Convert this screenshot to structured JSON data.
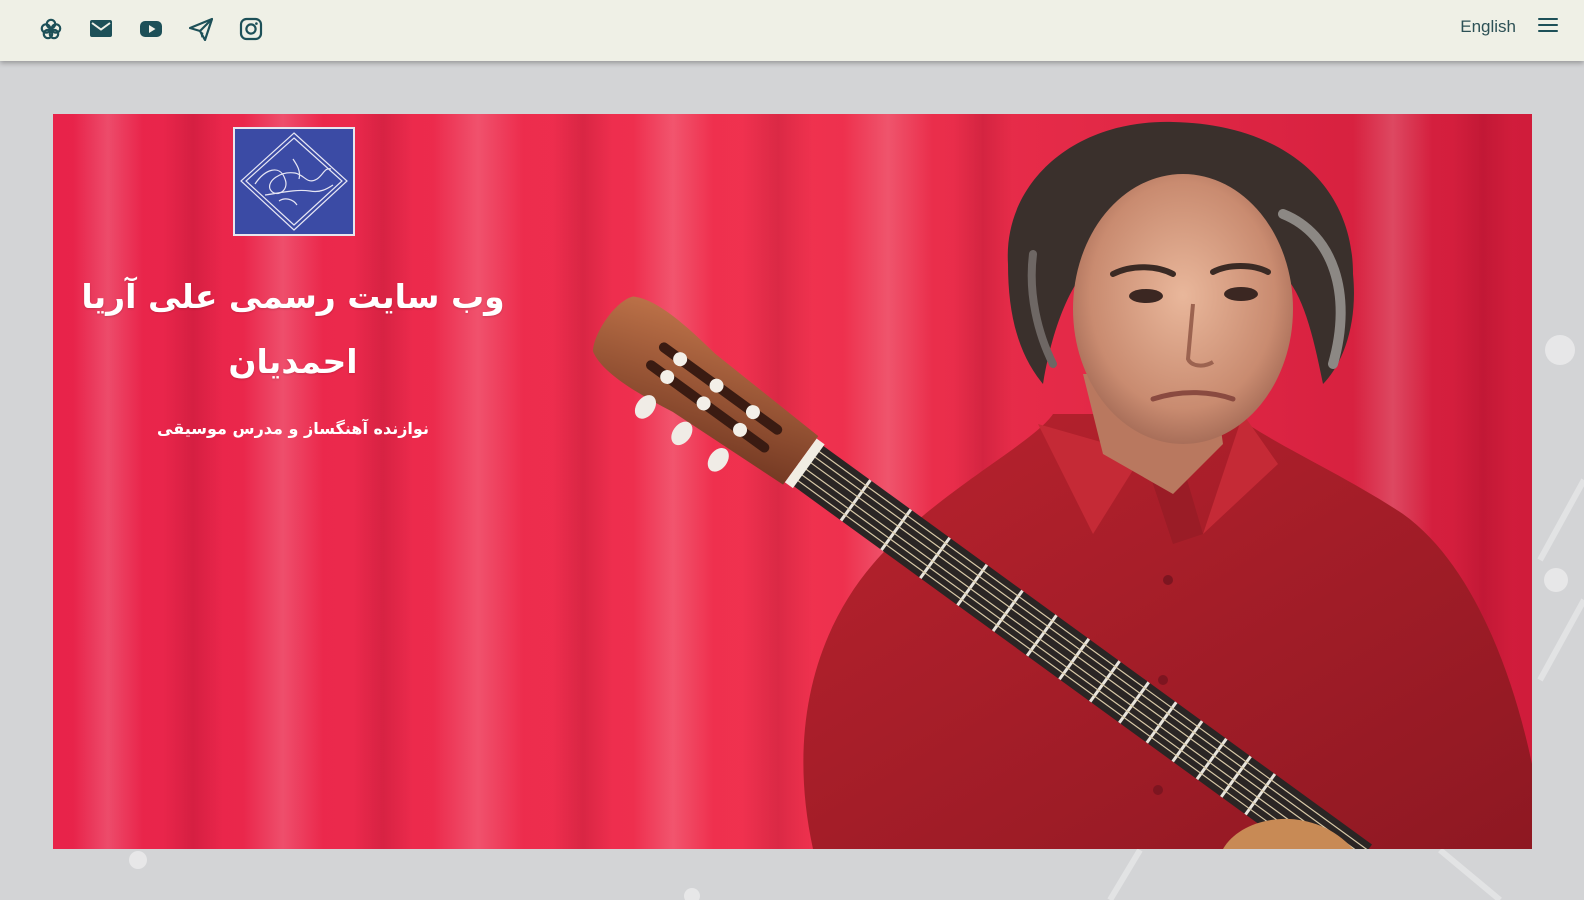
{
  "topbar": {
    "social_icons": [
      {
        "name": "flower-icon"
      },
      {
        "name": "mail-icon"
      },
      {
        "name": "youtube-icon"
      },
      {
        "name": "telegram-icon"
      },
      {
        "name": "instagram-icon"
      }
    ],
    "language_link": "English",
    "menu_icon": "hamburger-menu-icon"
  },
  "hero": {
    "logo_text": "علی آریا احمدیان",
    "title_line1": "وب سایت رسمی علی آریا",
    "title_line2": "احمدیان",
    "subtitle": "نوازنده آهنگساز و مدرس موسیقی",
    "photo": "portrait-with-guitar-image"
  },
  "colors": {
    "topbar_bg": "#eff0e6",
    "icon_color": "#1d5058",
    "page_bg": "#d3d4d6",
    "curtain_red": "#e8254a",
    "shirt_red": "#a8202a",
    "logo_blue": "#3a4aa3"
  }
}
